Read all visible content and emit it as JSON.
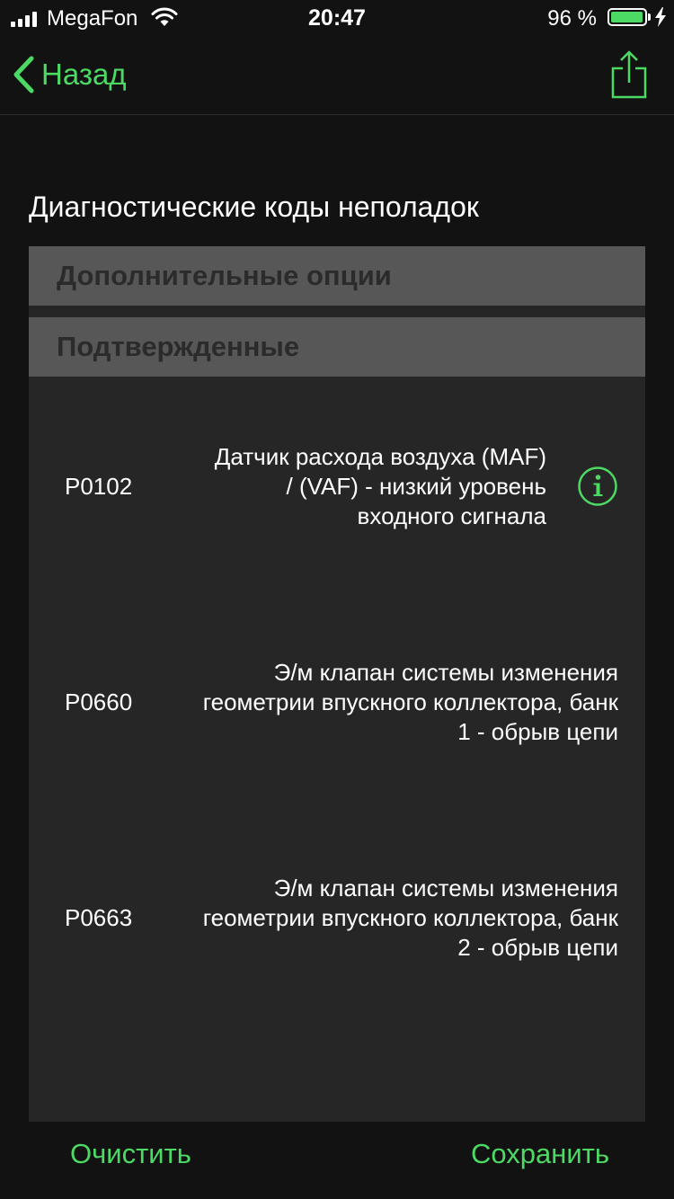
{
  "status_bar": {
    "carrier": "MegaFon",
    "time": "20:47",
    "battery_percent": "96 %",
    "battery_level": 0.96
  },
  "nav": {
    "back_label": "Назад",
    "share_icon": "share-icon"
  },
  "section_title": "Диагностические коды неполадок",
  "groups": {
    "additional": "Дополнительные опции",
    "confirmed": "Подтвержденные"
  },
  "codes": [
    {
      "code": "P0102",
      "description": "Датчик расхода воздуха (MAF) / (VAF) - низкий уровень входного сигнала",
      "has_info": true
    },
    {
      "code": "P0660",
      "description": "Э/м клапан системы изменения геометрии впускного коллектора, банк 1 - обрыв цепи",
      "has_info": false
    },
    {
      "code": "P0663",
      "description": "Э/м клапан системы изменения геометрии впускного коллектора, банк 2 - обрыв цепи",
      "has_info": false
    }
  ],
  "toolbar": {
    "clear_label": "Очистить",
    "save_label": "Сохранить"
  },
  "colors": {
    "accent": "#4cd964",
    "background": "#121212",
    "panel": "#262626",
    "group_header": "#575757"
  }
}
